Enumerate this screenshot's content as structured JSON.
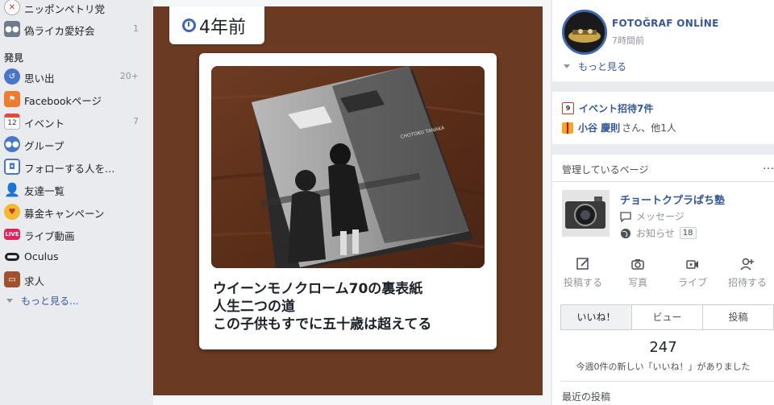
{
  "sidebar": {
    "items": [
      {
        "label": "ニッポンペトリ党",
        "count": "",
        "icon": "baseball-icon"
      },
      {
        "label": "偽ライカ愛好会",
        "count": "1",
        "icon": "group-icon"
      }
    ],
    "section_title": "発見",
    "discover": [
      {
        "label": "思い出",
        "count": "20+",
        "icon": "memories-icon"
      },
      {
        "label": "Facebookページ",
        "count": "",
        "icon": "flag-icon"
      },
      {
        "label": "イベント",
        "count": "7",
        "icon": "calendar-icon"
      },
      {
        "label": "グループ",
        "count": "",
        "icon": "groups-icon"
      },
      {
        "label": "フォローする人を…",
        "count": "",
        "icon": "follow-icon"
      },
      {
        "label": "友達一覧",
        "count": "",
        "icon": "friends-icon"
      },
      {
        "label": "募金キャンペーン",
        "count": "",
        "icon": "fundraiser-icon"
      },
      {
        "label": "ライブ動画",
        "count": "",
        "icon": "live-icon"
      },
      {
        "label": "Oculus",
        "count": "",
        "icon": "oculus-icon"
      },
      {
        "label": "求人",
        "count": "",
        "icon": "briefcase-icon"
      }
    ],
    "calendar_day": "12",
    "live_badge": "LIVE",
    "more_label": "もっと見る..."
  },
  "memory": {
    "badge": "4年前",
    "caption": [
      "ウイーンモノクローム70の裏表紙",
      "人生二つの道",
      "この子供もすでに五十歳は超えてる"
    ]
  },
  "right": {
    "page_post": {
      "name": "FOTOĞRAF ONLİNE",
      "time": "7時間前",
      "more": "もっと見る"
    },
    "events": {
      "invite": "イベント招待7件",
      "calendar_day": "9",
      "birthday_name": "小谷 慶則",
      "birthday_suffix": "さん、他1人"
    },
    "managed": {
      "header": "管理しているページ",
      "dots": "…",
      "page_name": "チョートクプラぱち塾",
      "messages": "メッセージ",
      "notifications": "お知らせ",
      "notif_count": "18",
      "actions": [
        "投稿する",
        "写真",
        "ライブ",
        "招待する"
      ],
      "tabs": [
        "いいね！",
        "ビュー",
        "投稿"
      ],
      "active_tab": 0,
      "likes": "247",
      "likes_note": "今週0件の新しい「いいね！」がありました",
      "recent": "最近の投稿"
    }
  },
  "colors": {
    "link": "#365899",
    "accent": "#4267b2",
    "memory_bg": "#6b3a22",
    "sidebar_bg": "#e9ebee"
  }
}
